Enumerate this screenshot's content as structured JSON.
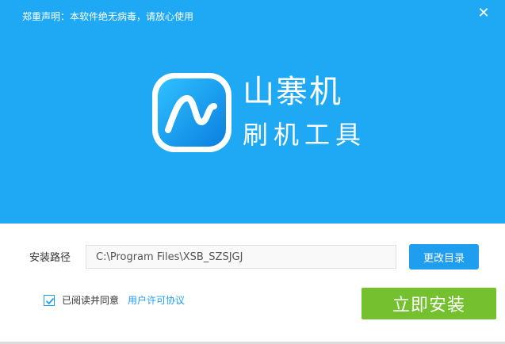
{
  "colors": {
    "banner": "#1fa9f5",
    "accent": "#1f9ef0",
    "install": "#74c02f"
  },
  "header": {
    "notice": "郑重声明：本软件绝无病毒，请放心使用",
    "close_glyph": "✕"
  },
  "logo": {
    "icon": "app-logo-icon",
    "title": "山寨机",
    "subtitle": "刷机工具"
  },
  "install_path": {
    "label": "安装路径",
    "value": "C:\\Program Files\\XSB_SZSJGJ",
    "browse_label": "更改目录"
  },
  "agreement": {
    "checked": true,
    "text": "已阅读并同意",
    "link_text": "用户许可协议"
  },
  "install_button": {
    "label": "立即安装"
  }
}
